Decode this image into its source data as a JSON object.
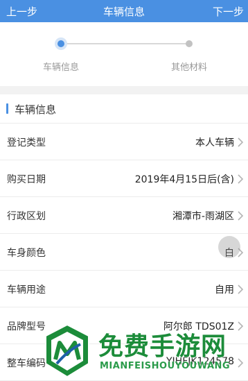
{
  "topbar": {
    "prev_label": "上一步",
    "title": "车辆信息",
    "next_label": "下一步",
    "background": "#4a90e2"
  },
  "stepper": {
    "steps": [
      {
        "label": "车辆信息",
        "state": "active"
      },
      {
        "label": "其他材料",
        "state": "pending"
      }
    ]
  },
  "section": {
    "title": "车辆信息",
    "accent": "#4a90e2"
  },
  "rows": [
    {
      "label": "登记类型",
      "value": "本人车辆"
    },
    {
      "label": "购买日期",
      "value": "2019年4月15日后(含)"
    },
    {
      "label": "行政区划",
      "value": "湘潭市-雨湖区"
    },
    {
      "label": "车身颜色",
      "value": "白"
    },
    {
      "label": "车辆用途",
      "value": "自用"
    },
    {
      "label": "品牌型号",
      "value": "阿尔郎 TDS01Z"
    },
    {
      "label": "整车编码",
      "value": "YIHFJK124578"
    }
  ],
  "icons": {
    "row_chevron": "chevron-right-icon"
  },
  "watermark": {
    "title": "免费手游网",
    "subtitle": "MIANFEISHOUYOUWANG",
    "color": "#1c8c3a"
  }
}
